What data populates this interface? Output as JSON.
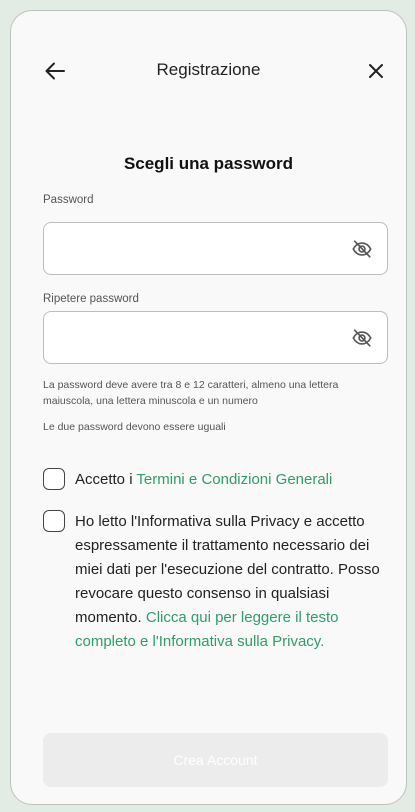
{
  "header": {
    "title": "Registrazione",
    "back_icon": "arrow-left-icon",
    "close_icon": "close-icon"
  },
  "page_title": "Scegli una password",
  "password": {
    "label": "Password",
    "value": "",
    "toggle_icon": "eye-off-icon"
  },
  "repeat_password": {
    "label": "Ripetere password",
    "value": "",
    "toggle_icon": "eye-off-icon"
  },
  "hints": {
    "rules": "La password deve avere tra 8 e 12 caratteri, almeno una lettera maiuscola, una lettera minuscola e un numero",
    "match": "Le due password devono essere uguali"
  },
  "terms": {
    "prefix": "Accetto i ",
    "link": "Termini e Condizioni Generali",
    "checked": false
  },
  "privacy": {
    "text": "Ho letto l'Informativa sulla Privacy e accetto espressamente il trattamento necessario dei miei dati per l'esecuzione del contratto. Posso revocare questo consenso in qualsiasi momento. ",
    "link": "Clicca qui per leggere il testo completo e l'Informativa sulla Privacy.",
    "checked": false
  },
  "cta": {
    "label": "Crea Account",
    "enabled": false
  },
  "colors": {
    "link": "#2f9c6b",
    "background": "#f9f9f9",
    "button_disabled": "#ececec"
  }
}
